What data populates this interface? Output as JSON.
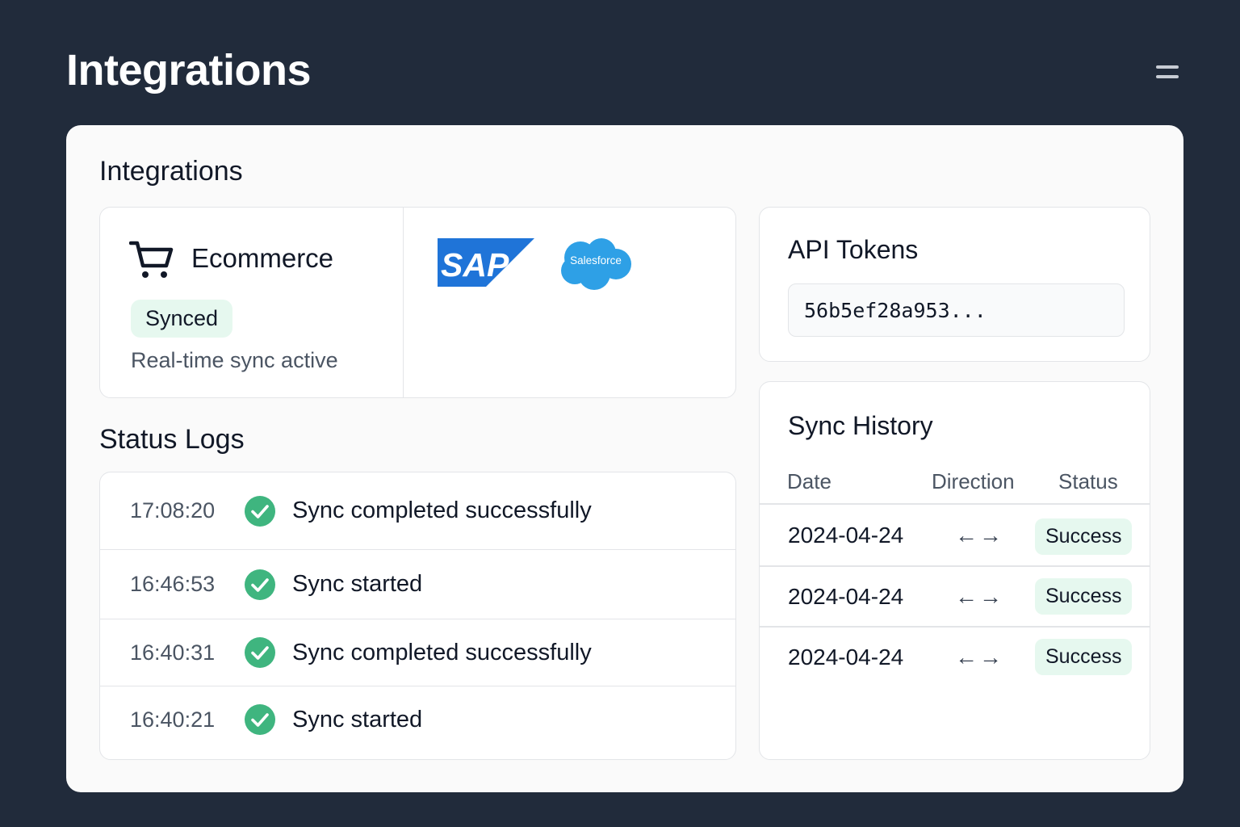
{
  "header": {
    "title": "Integrations",
    "menu_icon": "hamburger-icon"
  },
  "integrations": {
    "title": "Integrations",
    "ecommerce": {
      "icon": "cart-icon",
      "label": "Ecommerce",
      "status_badge": "Synced",
      "status_note": "Real-time sync active"
    },
    "partners": [
      {
        "name": "SAP",
        "logo_text": "SAP",
        "color": "#1f74d8"
      },
      {
        "name": "Salesforce",
        "logo_text": "Salesforce",
        "color": "#2ea0e6"
      }
    ]
  },
  "status_logs": {
    "title": "Status Logs",
    "entries": [
      {
        "time": "17:08:20",
        "message": "Sync completed successfully",
        "icon": "check-circle-icon"
      },
      {
        "time": "16:46:53",
        "message": "Sync started",
        "icon": "check-circle-icon"
      },
      {
        "time": "16:40:31",
        "message": "Sync completed successfully",
        "icon": "check-circle-icon"
      },
      {
        "time": "16:40:21",
        "message": "Sync started",
        "icon": "check-circle-icon"
      }
    ]
  },
  "api_tokens": {
    "title": "API Tokens",
    "token": "56b5ef28a953..."
  },
  "sync_history": {
    "title": "Sync History",
    "columns": [
      "Date",
      "Direction",
      "Status"
    ],
    "rows": [
      {
        "date": "2024-04-24",
        "direction": "←→",
        "status": "Success"
      },
      {
        "date": "2024-04-24",
        "direction": "←→",
        "status": "Success"
      },
      {
        "date": "2024-04-24",
        "direction": "←→",
        "status": "Success"
      }
    ]
  },
  "colors": {
    "background": "#212b3b",
    "card": "#fafafa",
    "success": "#3fb57f",
    "success_bg": "#e6f8ef"
  }
}
